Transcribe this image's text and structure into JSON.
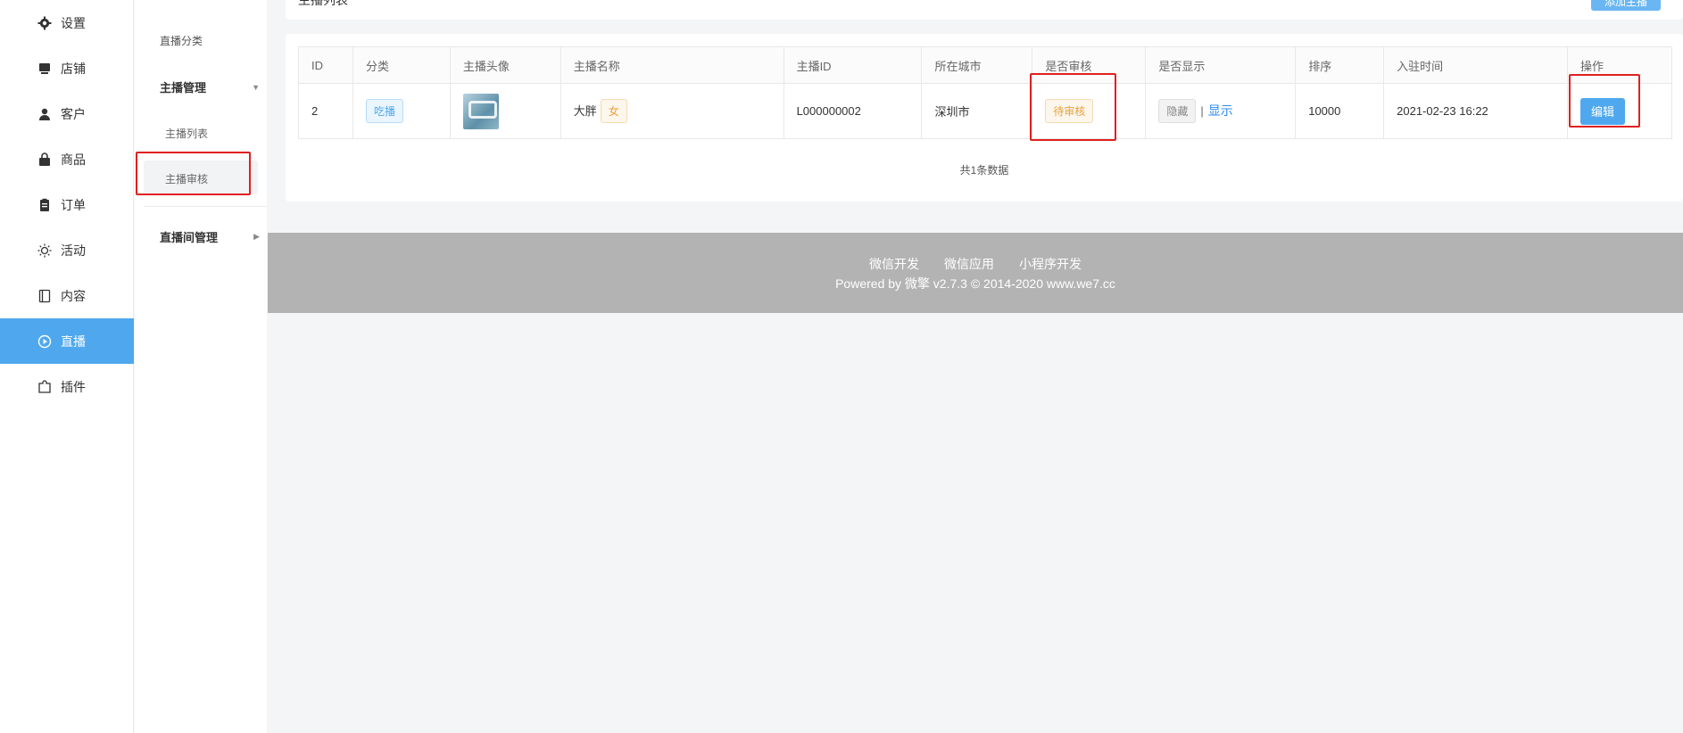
{
  "nav": {
    "items": [
      {
        "label": "设置",
        "icon": "gear-icon"
      },
      {
        "label": "店铺",
        "icon": "store-icon"
      },
      {
        "label": "客户",
        "icon": "user-icon"
      },
      {
        "label": "商品",
        "icon": "bag-icon"
      },
      {
        "label": "订单",
        "icon": "clipboard-icon"
      },
      {
        "label": "活动",
        "icon": "sun-icon"
      },
      {
        "label": "内容",
        "icon": "book-icon"
      },
      {
        "label": "直播",
        "icon": "play-circle-icon"
      },
      {
        "label": "插件",
        "icon": "puzzle-icon"
      }
    ],
    "active": "直播"
  },
  "subnav": {
    "category": "直播分类",
    "anchor_group": "主播管理",
    "anchor_list": "主播列表",
    "anchor_review": "主播审核",
    "room_group": "直播间管理"
  },
  "topbar": {
    "title": "主播列表",
    "add_button": "添加主播"
  },
  "table": {
    "headers": [
      "ID",
      "分类",
      "主播头像",
      "主播名称",
      "主播ID",
      "所在城市",
      "是否审核",
      "是否显示",
      "排序",
      "入驻时间",
      "操作"
    ],
    "rows": [
      {
        "id": "2",
        "category": "吃播",
        "name": "大胖",
        "gender": "女",
        "anchor_id": "L000000002",
        "city": "深圳市",
        "review_status": "待审核",
        "hide_label": "隐藏",
        "separator": "|",
        "show_label": "显示",
        "sort": "10000",
        "joined": "2021-02-23 16:22",
        "edit_label": "编辑"
      }
    ],
    "summary": "共1条数据"
  },
  "footer": {
    "links": [
      "微信开发",
      "微信应用",
      "小程序开发"
    ],
    "copyright": "Powered by 微擎 v2.7.3 © 2014-2020 www.we7.cc"
  },
  "colors": {
    "accent": "#4fa8ee",
    "highlight": "#e02020",
    "footer_bg": "#b3b3b3"
  }
}
